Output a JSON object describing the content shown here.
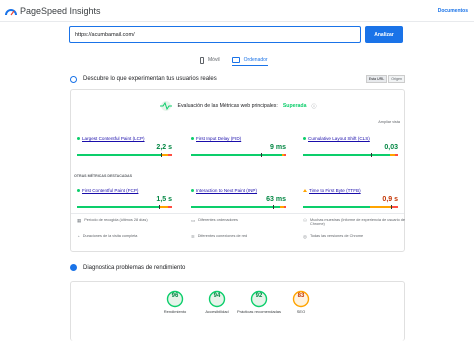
{
  "header": {
    "brand": "PageSpeed Insights",
    "docs": "Documentos"
  },
  "search": {
    "url": "https://acumbamail.com/",
    "analyze": "Analizar"
  },
  "tabs": [
    {
      "label": "Móvil"
    },
    {
      "label": "Ordenador"
    }
  ],
  "users": {
    "title": "Descubre lo que experimentan tus usuarios reales",
    "url_pill": "Esta URL",
    "origin_pill": "Origen",
    "cwv_label": "Evaluación de las Métricas web principales:",
    "cwv_status": "Superada",
    "expand": "Ampliar vista",
    "section_label": "OTRAS MÉTRICAS DESTACADAS"
  },
  "metrics": [
    {
      "name": "Largest Contentful Paint (LCP)",
      "value": "2,2 s",
      "status": "good"
    },
    {
      "name": "First Input Delay (FID)",
      "value": "9 ms",
      "status": "good"
    },
    {
      "name": "Cumulative Layout Shift (CLS)",
      "value": "0,03",
      "status": "good"
    },
    {
      "name": "First Contentful Paint (FCP)",
      "value": "1,5 s",
      "status": "good"
    },
    {
      "name": "Interaction to Next Paint (INP)",
      "value": "63 ms",
      "status": "good"
    },
    {
      "name": "Time to First Byte (TTFB)",
      "value": "0,9 s",
      "status": "average"
    }
  ],
  "info": [
    "Período de recogida (últimos 28 días)",
    "Diferentes ordenadores",
    "Muchas muestras (Informe de experiencia de usuario de Chrome)",
    "Duraciones de la visita completa",
    "Diferentes conexiones de red",
    "Todas las versiones de Chrome"
  ],
  "diag": {
    "title": "Diagnostica problemas de rendimiento"
  },
  "scores": [
    {
      "value": "96",
      "label": "Rendimiento",
      "color": "#0cce6b"
    },
    {
      "value": "94",
      "label": "Accesibilidad",
      "color": "#0cce6b"
    },
    {
      "value": "92",
      "label": "Prácticas recomendadas",
      "color": "#0cce6b"
    },
    {
      "value": "83",
      "label": "SEO",
      "color": "#ffa400"
    }
  ],
  "colors": {
    "accent": "#1a73e8",
    "good": "#0cce6b",
    "average": "#ffa400",
    "poor": "#ff4e42"
  }
}
